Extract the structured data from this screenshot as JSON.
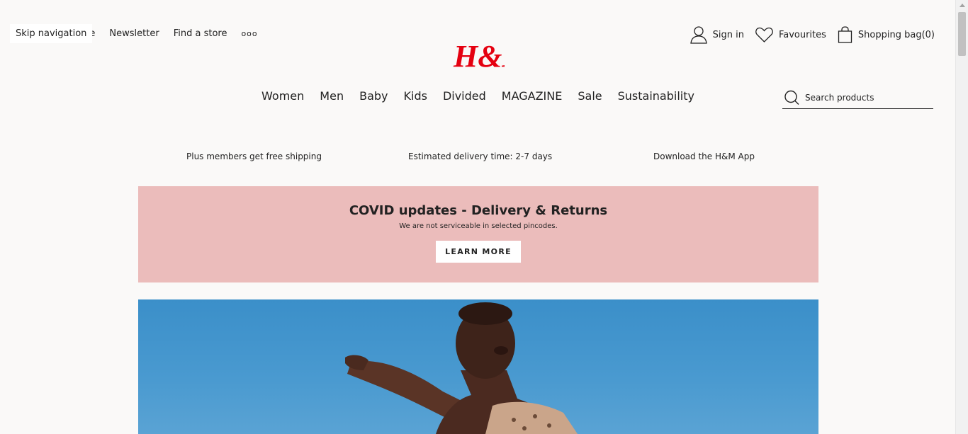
{
  "header": {
    "skip_nav": "Skip navigation",
    "clipped_link": "e",
    "newsletter": "Newsletter",
    "find_store": "Find a store",
    "more": "ooo",
    "sign_in": "Sign in",
    "favourites": "Favourites",
    "shopping_bag": "Shopping bag",
    "bag_count": "(0)",
    "brand_color": "#e50010"
  },
  "nav": {
    "items": [
      "Women",
      "Men",
      "Baby",
      "Kids",
      "Divided",
      "MAGAZINE",
      "Sale",
      "Sustainability"
    ]
  },
  "search": {
    "placeholder": "Search products"
  },
  "promos": [
    "Plus members get free shipping",
    "Estimated delivery time: 2-7 days",
    "Download the H&M App"
  ],
  "covid_banner": {
    "title": "COVID updates - Delivery & Returns",
    "subtitle": "We are not serviceable in selected pincodes.",
    "button": "LEARN MORE",
    "background": "#ebbcbb"
  },
  "hero": {
    "background": "#4a9ad0"
  }
}
